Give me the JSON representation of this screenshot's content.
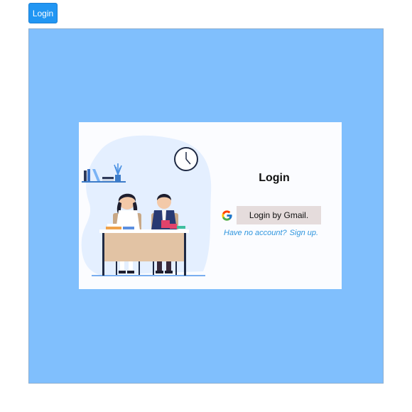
{
  "top_button": {
    "label": "Login"
  },
  "modal": {
    "title": "Login",
    "google_button_label": "Login by Gmail.",
    "no_account_text": "Have no account?",
    "signup_link_text": "Sign up."
  },
  "colors": {
    "overlay": "#80bffd",
    "primary_button": "#2196f3",
    "gmail_button_bg": "#e5dcdc",
    "link": "#2e95de",
    "card": "#fbfcff"
  },
  "icons": {
    "google": "google-g-icon",
    "clock": "clock-icon",
    "illustration": "students-at-desk-illustration"
  }
}
